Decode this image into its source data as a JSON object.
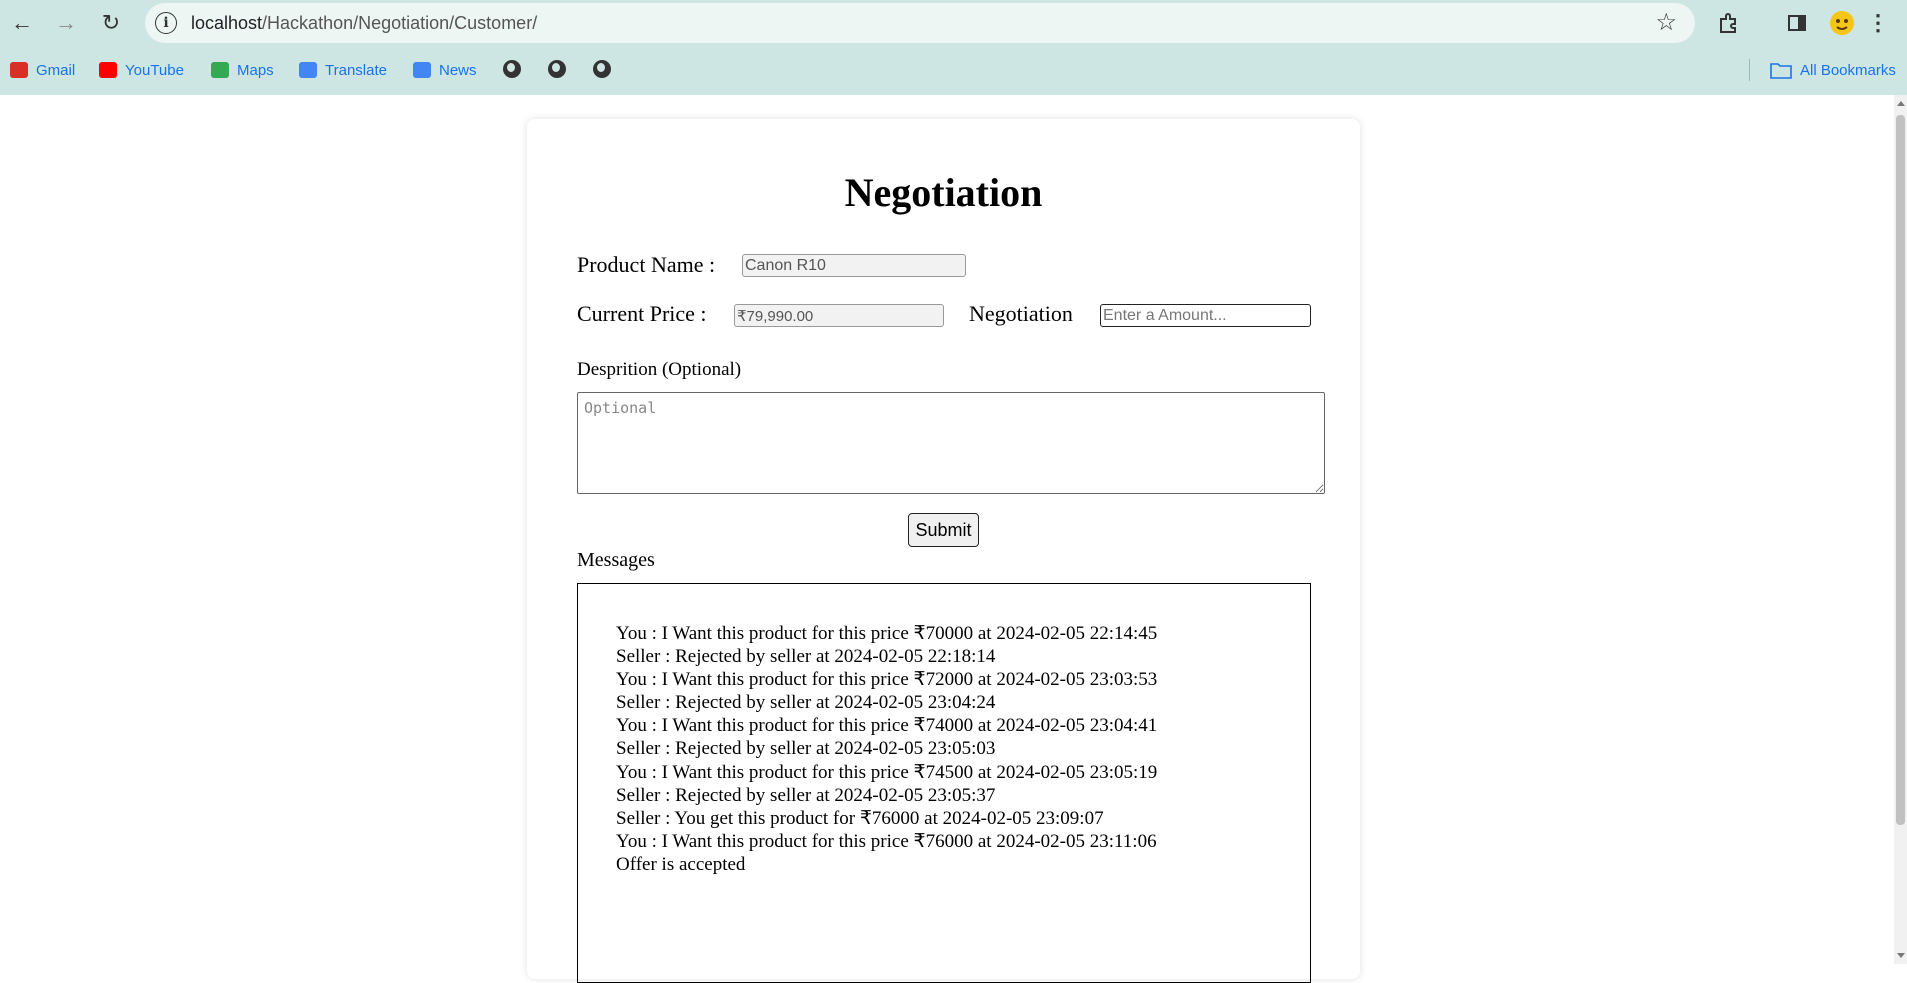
{
  "browser": {
    "url_host": "localhost",
    "url_path": "/Hackathon/Negotiation/Customer/",
    "bookmarks": [
      {
        "label": "Gmail",
        "icon": "gmail-icon",
        "color": "#d93025"
      },
      {
        "label": "YouTube",
        "icon": "youtube-icon",
        "color": "#ff0000"
      },
      {
        "label": "Maps",
        "icon": "maps-icon",
        "color": "#34a853"
      },
      {
        "label": "Translate",
        "icon": "translate-icon",
        "color": "#4285f4"
      },
      {
        "label": "News",
        "icon": "news-icon",
        "color": "#4285f4"
      }
    ],
    "all_bookmarks_label": "All Bookmarks"
  },
  "page": {
    "title": "Negotiation",
    "product_name_label": "Product Name :",
    "product_name_value": "Canon R10",
    "current_price_label": "Current Price :",
    "current_price_value": "₹79,990.00",
    "negotiation_label": "Negotiation",
    "negotiation_placeholder": "Enter a Amount...",
    "description_label": "Desprition (Optional)",
    "description_placeholder": "Optional",
    "submit_label": "Submit",
    "messages_label": "Messages",
    "messages": [
      "You : I Want this product for this price ₹70000 at 2024-02-05 22:14:45",
      "Seller : Rejected by seller at 2024-02-05 22:18:14",
      "You : I Want this product for this price ₹72000 at 2024-02-05 23:03:53",
      "Seller : Rejected by seller at 2024-02-05 23:04:24",
      "You : I Want this product for this price ₹74000 at 2024-02-05 23:04:41",
      "Seller : Rejected by seller at 2024-02-05 23:05:03",
      "You : I Want this product for this price ₹74500 at 2024-02-05 23:05:19",
      "Seller : Rejected by seller at 2024-02-05 23:05:37",
      "Seller : You get this product for ₹76000 at 2024-02-05 23:09:07",
      "You : I Want this product for this price ₹76000 at 2024-02-05 23:11:06",
      "Offer is accepted"
    ]
  }
}
